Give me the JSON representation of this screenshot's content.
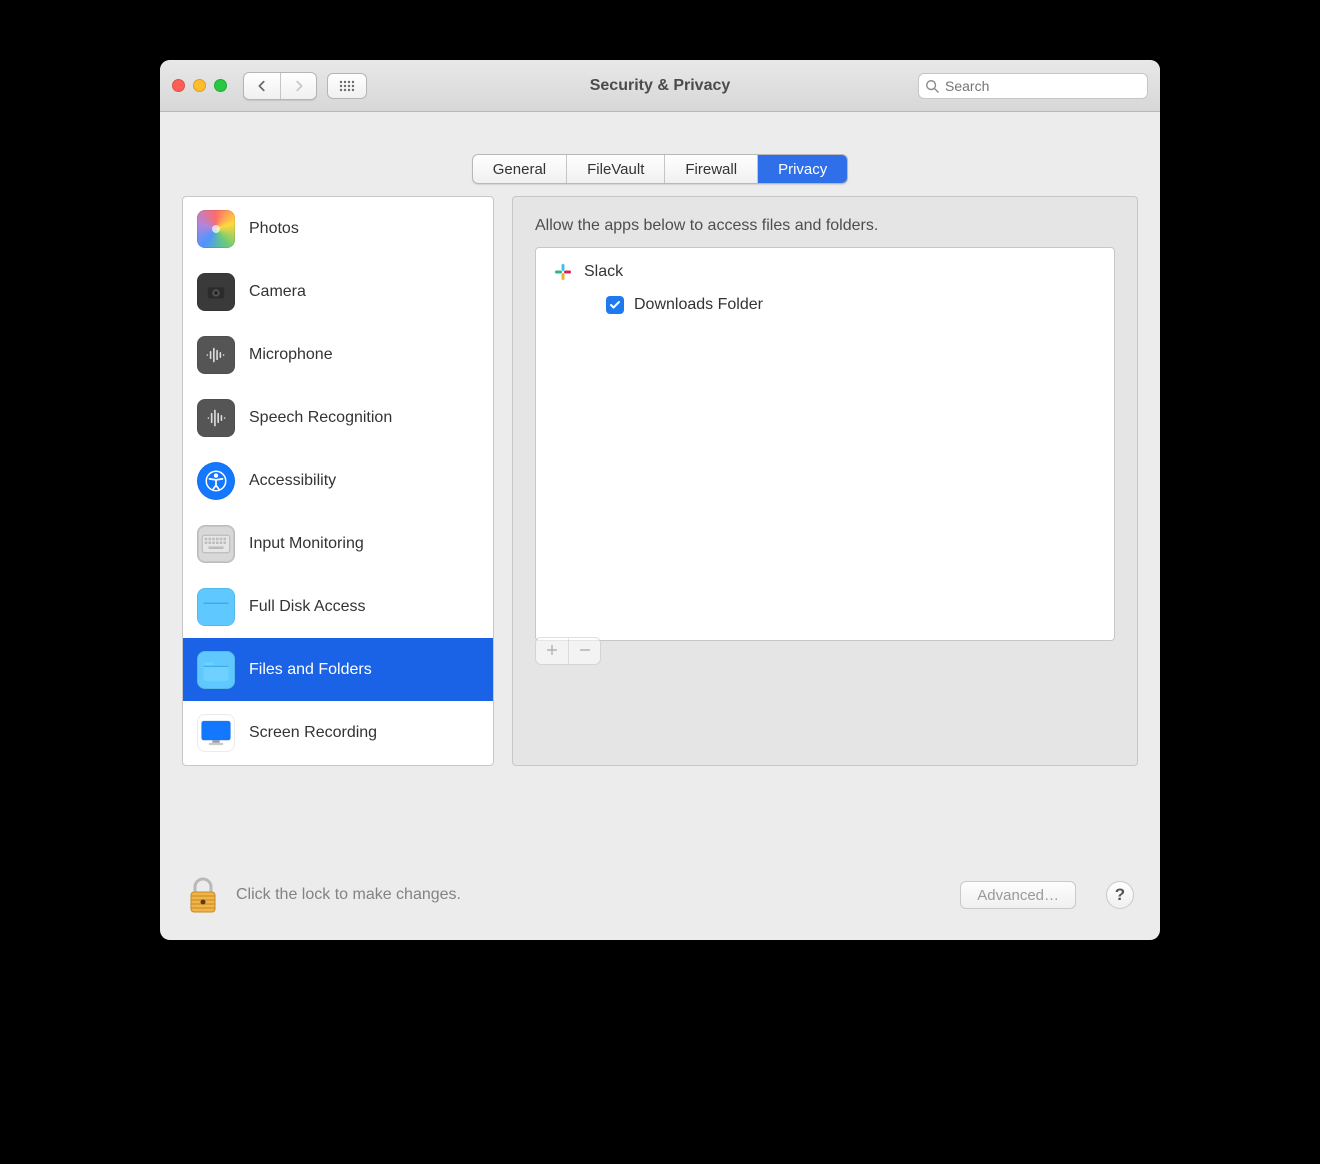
{
  "window": {
    "title": "Security & Privacy"
  },
  "search": {
    "placeholder": "Search"
  },
  "tabs": {
    "general": "General",
    "filevault": "FileVault",
    "firewall": "Firewall",
    "privacy": "Privacy",
    "active": "privacy"
  },
  "sidebar": {
    "items": [
      {
        "key": "photos",
        "label": "Photos"
      },
      {
        "key": "camera",
        "label": "Camera"
      },
      {
        "key": "microphone",
        "label": "Microphone"
      },
      {
        "key": "speech",
        "label": "Speech Recognition"
      },
      {
        "key": "accessibility",
        "label": "Accessibility"
      },
      {
        "key": "inputmon",
        "label": "Input Monitoring"
      },
      {
        "key": "fulldisk",
        "label": "Full Disk Access"
      },
      {
        "key": "filesfolders",
        "label": "Files and Folders"
      },
      {
        "key": "screenrec",
        "label": "Screen Recording"
      }
    ],
    "selected": "filesfolders"
  },
  "detail": {
    "heading": "Allow the apps below to access files and folders.",
    "app": {
      "name": "Slack"
    },
    "entitlement": {
      "label": "Downloads Folder",
      "checked": true
    }
  },
  "footer": {
    "lock_text": "Click the lock to make changes.",
    "advanced": "Advanced…",
    "help": "?"
  }
}
